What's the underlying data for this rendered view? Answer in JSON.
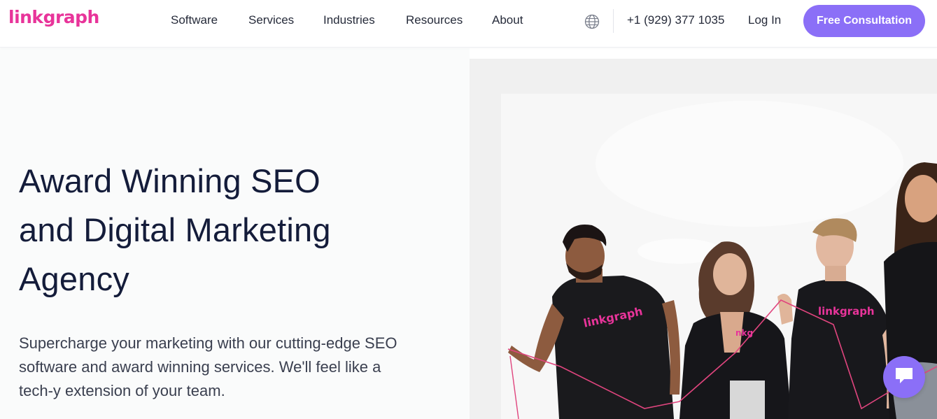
{
  "brand": {
    "logo_text": "linkgraph",
    "accent": "#e8349a",
    "button_color": "#8b6ff7"
  },
  "nav": {
    "items": [
      "Software",
      "Services",
      "Industries",
      "Resources",
      "About"
    ],
    "phone": "+1 (929) 377 1035",
    "login": "Log In",
    "cta": "Free Consultation",
    "language_icon": "globe-icon"
  },
  "hero": {
    "headline_lines": [
      "Award Winning SEO",
      "and Digital Marketing",
      "Agency"
    ],
    "subtext": "Supercharge your marketing with our cutting-edge SEO software and award winning services. We'll feel like a tech-y extension of your team.",
    "image": {
      "shirt_text": "linkgraph",
      "shirt_text_partial": "nkg"
    }
  },
  "chat": {
    "icon": "chat-bubble-icon"
  }
}
